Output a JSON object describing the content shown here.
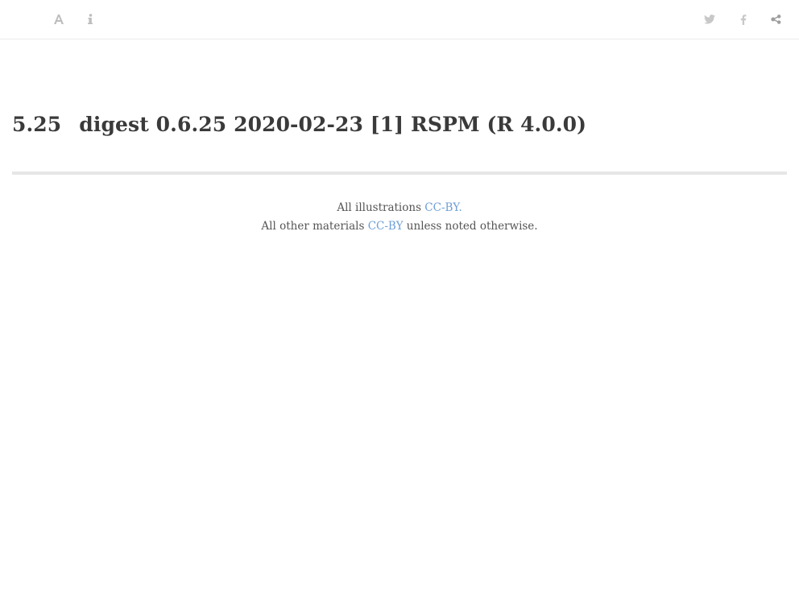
{
  "toolbar": {
    "left_buttons": [
      {
        "name": "font-settings",
        "icon": "font-icon"
      },
      {
        "name": "info",
        "icon": "info-icon"
      }
    ],
    "right_buttons": [
      {
        "name": "twitter",
        "icon": "twitter-icon"
      },
      {
        "name": "facebook",
        "icon": "facebook-icon"
      },
      {
        "name": "share",
        "icon": "share-icon"
      }
    ],
    "icon_color": "#bdbdbd"
  },
  "main": {
    "section_number": "5.25",
    "title": "digest 0.6.25 2020-02-23 [1] RSPM (R 4.0.0)"
  },
  "footer": {
    "line1_prefix": "All illustrations ",
    "line1_link": "CC-BY.",
    "line2_prefix": "All other materials ",
    "line2_link": "CC-BY",
    "line2_suffix": " unless noted otherwise.",
    "link_color": "#6c9ed6"
  }
}
